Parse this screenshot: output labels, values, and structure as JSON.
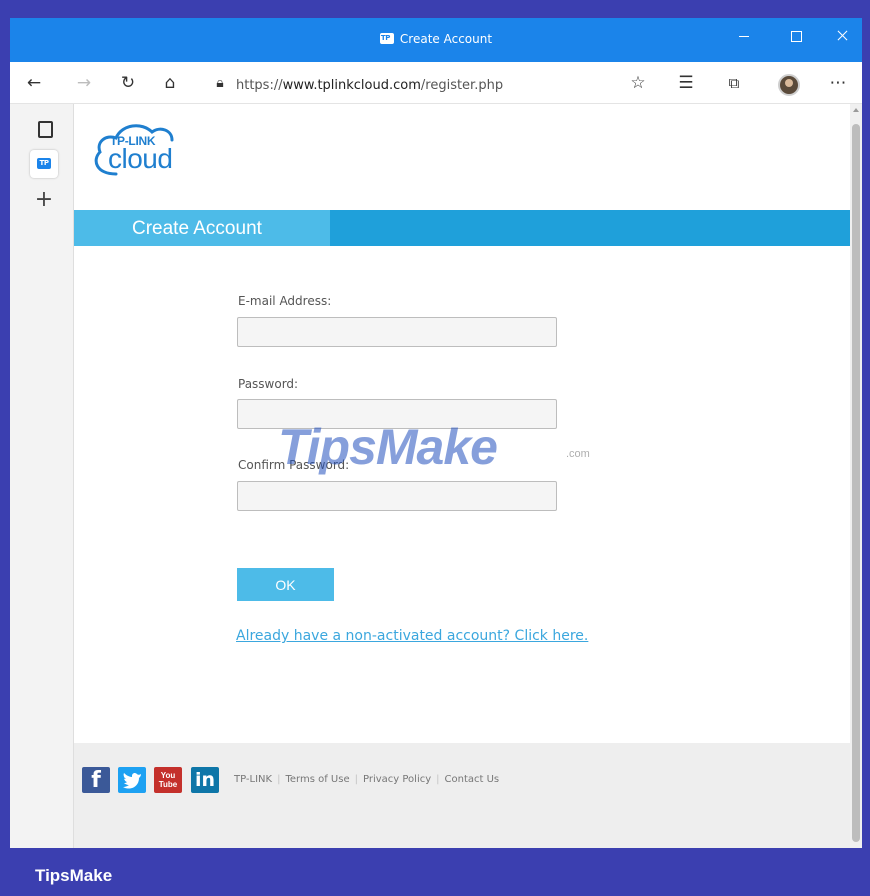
{
  "window": {
    "title": "Create Account"
  },
  "toolbar": {
    "url_prefix": "https://",
    "url_domain": "www.tplinkcloud.com",
    "url_path": "/register.php"
  },
  "logo": {
    "brand_top": "TP-LINK",
    "brand_bottom": "cloud"
  },
  "page": {
    "section_tab": "Create Account"
  },
  "form": {
    "email_label": "E-mail Address:",
    "email_value": "",
    "password_label": "Password:",
    "password_value": "",
    "confirm_label": "Confirm Password:",
    "confirm_value": "",
    "ok_label": "OK",
    "link_text": "Already have a non-activated account? Click here."
  },
  "footer": {
    "social": [
      "f",
      "You Tube",
      "in"
    ],
    "links": [
      "TP-LINK",
      "Terms of Use",
      "Privacy Policy",
      "Contact Us"
    ]
  },
  "watermark": {
    "text": "TipsMake",
    "suffix": ".com"
  },
  "brand_caption": "TipsMake",
  "icons": {
    "back": "arrow-left-icon",
    "forward": "arrow-right-icon",
    "refresh": "refresh-icon",
    "home": "home-icon",
    "lock": "lock-icon",
    "favorite": "star-add-icon",
    "favorites": "favorites-list-icon",
    "collections": "collections-icon",
    "more": "ellipsis-icon"
  },
  "colors": {
    "titlebar": "#1b84ea",
    "band": "#1fa0da",
    "tab": "#4dbbe8",
    "link": "#3ba7de",
    "background": "#3b3fb0"
  }
}
